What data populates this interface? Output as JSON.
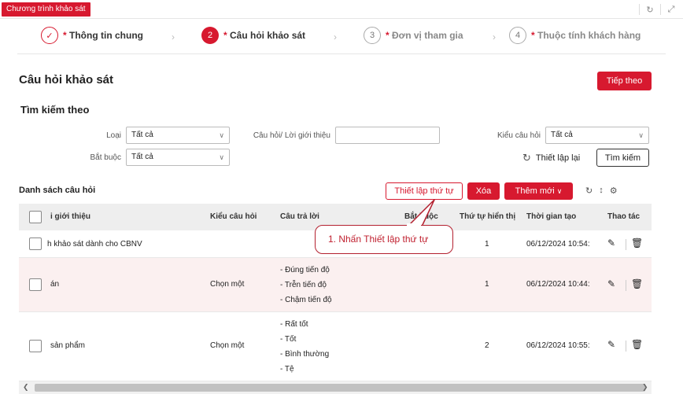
{
  "window": {
    "tab_title": "Chương trình khảo sát",
    "icons": [
      "refresh-icon",
      "expand-icon"
    ]
  },
  "stepper": {
    "steps": [
      {
        "number": "✓",
        "label": "Thông tin chung",
        "state": "done"
      },
      {
        "number": "2",
        "label": "Câu hỏi khảo sát",
        "state": "active"
      },
      {
        "number": "3",
        "label": "Đơn vị tham gia",
        "state": "todo"
      },
      {
        "number": "4",
        "label": "Thuộc tính khách hàng",
        "state": "todo"
      }
    ],
    "required_mark": "*"
  },
  "header": {
    "title": "Câu hỏi khảo sát",
    "next_label": "Tiếp theo"
  },
  "search": {
    "title": "Tìm kiếm theo",
    "type_label": "Loại",
    "type_value": "Tất cả",
    "question_label": "Câu hỏi/ Lời giới thiệu",
    "question_value": "",
    "kind_label": "Kiểu câu hỏi",
    "kind_value": "Tất cả",
    "required_label": "Bắt buộc",
    "required_value": "Tất cả",
    "reset_label": "Thiết lập lại",
    "search_label": "Tìm kiếm"
  },
  "list": {
    "title": "Danh sách câu hỏi",
    "order_label": "Thiết lập thứ tự",
    "delete_label": "Xóa",
    "add_label": "Thêm mới",
    "columns": [
      "i giới thiệu",
      "Kiểu câu hỏi",
      "Câu trả lời",
      "Bắt buộc",
      "Thứ tự hiển thị",
      "Thời gian tạo",
      "Thao tác"
    ],
    "rows": [
      {
        "intro": "h khảo sát dành cho CBNV",
        "kind": "",
        "answers": [],
        "required": "",
        "order": "1",
        "created": "06/12/2024 10:54:"
      },
      {
        "intro": "án",
        "kind": "Chọn một",
        "answers": [
          "- Đúng tiến độ",
          "- Trễn tiến độ",
          "- Chậm tiến độ"
        ],
        "required": "",
        "order": "1",
        "created": "06/12/2024 10:44:"
      },
      {
        "intro": "sản phẩm",
        "kind": "Chọn một",
        "answers": [
          "- Rất tốt",
          "- Tốt",
          "- Bình thường",
          "- Tệ"
        ],
        "required": "",
        "order": "2",
        "created": "06/12/2024 10:55:"
      }
    ]
  },
  "callout": {
    "text": "1. Nhấn Thiết lập thứ tự"
  },
  "colors": {
    "accent": "#d7192f",
    "callout_border": "#b3202f",
    "row_highlight": "#fbf0f0",
    "header_bg": "#eeeeee"
  }
}
